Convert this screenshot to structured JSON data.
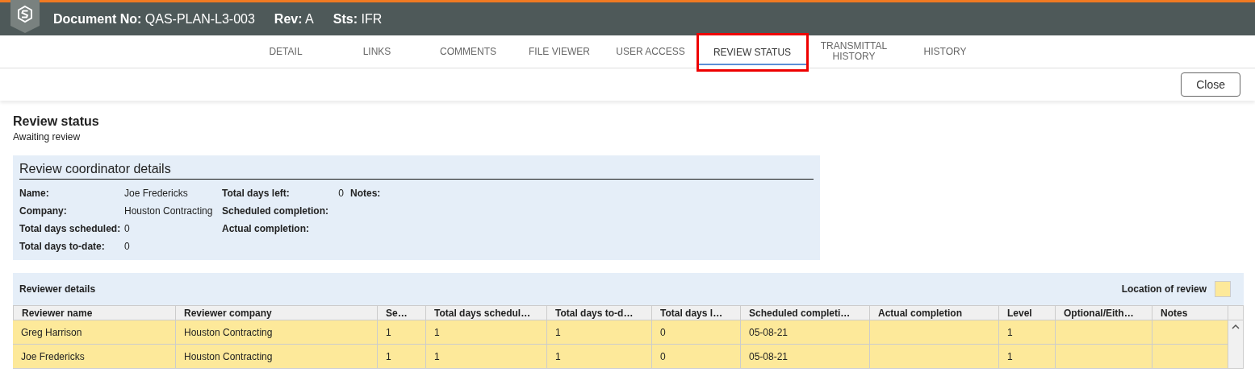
{
  "header": {
    "fields": [
      {
        "label": "Document No:",
        "value": "QAS-PLAN-L3-003"
      },
      {
        "label": "Rev:",
        "value": "A"
      },
      {
        "label": "Sts:",
        "value": "IFR"
      }
    ]
  },
  "tabs": [
    {
      "label": "DETAIL",
      "selected": false,
      "outlined": false
    },
    {
      "label": "LINKS",
      "selected": false,
      "outlined": false
    },
    {
      "label": "COMMENTS",
      "selected": false,
      "outlined": false
    },
    {
      "label": "FILE VIEWER",
      "selected": false,
      "outlined": false
    },
    {
      "label": "USER ACCESS",
      "selected": false,
      "outlined": false
    },
    {
      "label": "REVIEW STATUS",
      "selected": true,
      "outlined": true
    },
    {
      "label": "TRANSMITTAL HISTORY",
      "selected": false,
      "outlined": false
    },
    {
      "label": "HISTORY",
      "selected": false,
      "outlined": false
    }
  ],
  "actions": {
    "close": "Close"
  },
  "page": {
    "title": "Review status",
    "subtitle": "Awaiting review"
  },
  "coordinator": {
    "title": "Review coordinator details",
    "fields": [
      {
        "label": "Name:",
        "value": "Joe Fredericks"
      },
      {
        "label": "Company:",
        "value": "Houston Contracting"
      },
      {
        "label": "Total days scheduled:",
        "value": "0"
      },
      {
        "label": "Total days to-date:",
        "value": "0"
      },
      {
        "label": "Total days left:",
        "value": "0"
      },
      {
        "label": "Scheduled completion:"
      },
      {
        "label": "Actual completion:"
      },
      {
        "label": "Notes:"
      }
    ]
  },
  "reviewers": {
    "title": "Reviewer details",
    "legend": {
      "label": "Location of review",
      "color": "#fde99a"
    },
    "columns": [
      "Reviewer name",
      "Reviewer company",
      "Se…",
      "Total days schedul…",
      "Total days to-d…",
      "Total days l…",
      "Scheduled completi…",
      "Actual completion",
      "Level",
      "Optional/Eith…",
      "Notes"
    ],
    "rows": [
      {
        "cells": [
          "Greg Harrison",
          "Houston Contracting",
          "1",
          "1",
          "1",
          "0",
          "05-08-21",
          "",
          "1",
          "",
          ""
        ]
      },
      {
        "cells": [
          "Joe Fredericks",
          "Houston Contracting",
          "1",
          "1",
          "1",
          "0",
          "05-08-21",
          "",
          "1",
          "",
          ""
        ]
      }
    ]
  }
}
